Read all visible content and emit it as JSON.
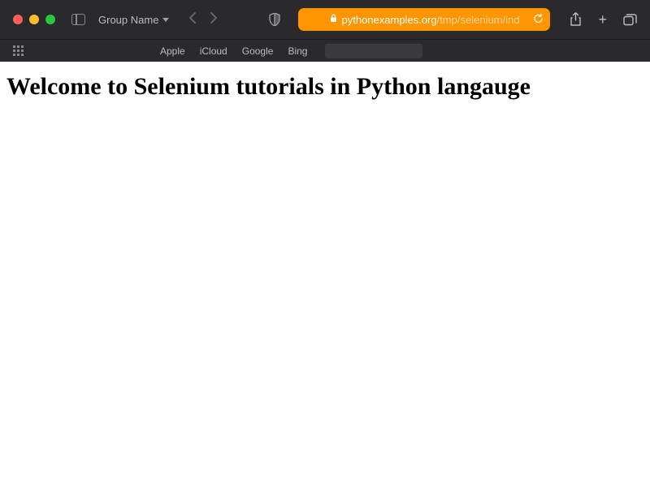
{
  "titlebar": {
    "group_label": "Group Name"
  },
  "address": {
    "host": "pythonexamples.org",
    "path": "/tmp/selenium/ind"
  },
  "favorites": {
    "items": [
      "Apple",
      "iCloud",
      "Google",
      "Bing"
    ]
  },
  "page": {
    "heading": "Welcome to Selenium tutorials in Python langauge"
  }
}
